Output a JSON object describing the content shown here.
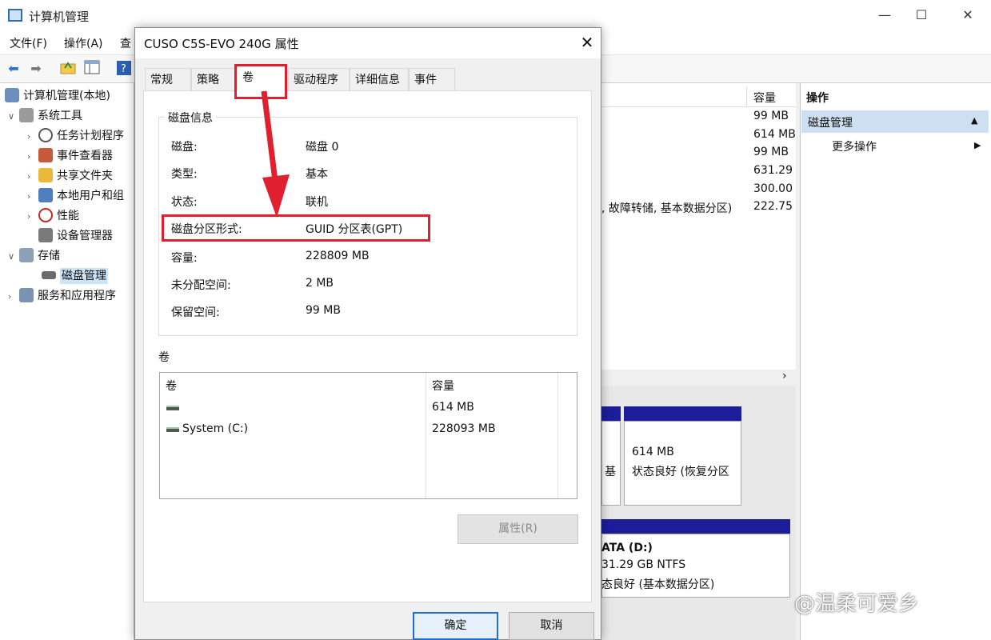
{
  "window": {
    "title": "计算机管理",
    "controls": {
      "minimize": "—",
      "maximize": "☐",
      "close": "✕"
    }
  },
  "menubar": {
    "items": [
      "文件(F)",
      "操作(A)",
      "查"
    ]
  },
  "tree": {
    "items": [
      {
        "label": "计算机管理(本地)",
        "expander": ""
      },
      {
        "label": "系统工具",
        "expander": "∨"
      },
      {
        "label": "任务计划程序",
        "expander": "›"
      },
      {
        "label": "事件查看器",
        "expander": "›"
      },
      {
        "label": "共享文件夹",
        "expander": "›"
      },
      {
        "label": "本地用户和组",
        "expander": "›"
      },
      {
        "label": "性能",
        "expander": "›"
      },
      {
        "label": "设备管理器",
        "expander": ""
      },
      {
        "label": "存储",
        "expander": "∨"
      },
      {
        "label": "磁盘管理",
        "expander": ""
      },
      {
        "label": "服务和应用程序",
        "expander": "›"
      }
    ]
  },
  "middle": {
    "capacity_header": "容量",
    "capacity_values": [
      "99 MB",
      "614 MB",
      "99 MB",
      "631.29",
      "300.00",
      "222.75"
    ],
    "row_text": ", 故障转储, 基本数据分区)",
    "scroll_arrow": "›",
    "diskmap": {
      "partition_a": {
        "size": "614 MB",
        "status": "状态良好 (恢复分区"
      },
      "partition_b_fragment": "基",
      "data_volume": {
        "name": "ATA  (D:)",
        "size": "31.29 GB NTFS",
        "status": "态良好 (基本数据分区)"
      }
    }
  },
  "actions": {
    "title": "操作",
    "section": "磁盘管理",
    "section_arrow": "▲",
    "more": "更多操作",
    "more_arrow": "▶"
  },
  "dialog": {
    "title": "CUSO C5S-EVO 240G 属性",
    "close": "✕",
    "tabs": [
      "常规",
      "策略",
      "卷",
      "驱动程序",
      "详细信息",
      "事件"
    ],
    "disk_info": {
      "group_label": "磁盘信息",
      "rows": [
        {
          "label": "磁盘:",
          "value": "磁盘 0"
        },
        {
          "label": "类型:",
          "value": "基本"
        },
        {
          "label": "状态:",
          "value": "联机"
        },
        {
          "label": "磁盘分区形式:",
          "value": "GUID 分区表(GPT)"
        },
        {
          "label": "容量:",
          "value": "228809 MB"
        },
        {
          "label": "未分配空间:",
          "value": "2 MB"
        },
        {
          "label": "保留空间:",
          "value": "99 MB"
        }
      ]
    },
    "volumes": {
      "label": "卷",
      "col_volume": "卷",
      "col_capacity": "容量",
      "rows": [
        {
          "name": "",
          "capacity": "614 MB"
        },
        {
          "name": "System (C:)",
          "capacity": "228093 MB"
        }
      ]
    },
    "properties_button": "属性(R)",
    "ok_button": "确定",
    "cancel_button": "取消"
  },
  "watermark": "@温柔可爱乡",
  "colors": {
    "annotation_red": "#e0202f",
    "selection_blue": "#cde0f2",
    "disk_bar": "#1d1d9a"
  }
}
